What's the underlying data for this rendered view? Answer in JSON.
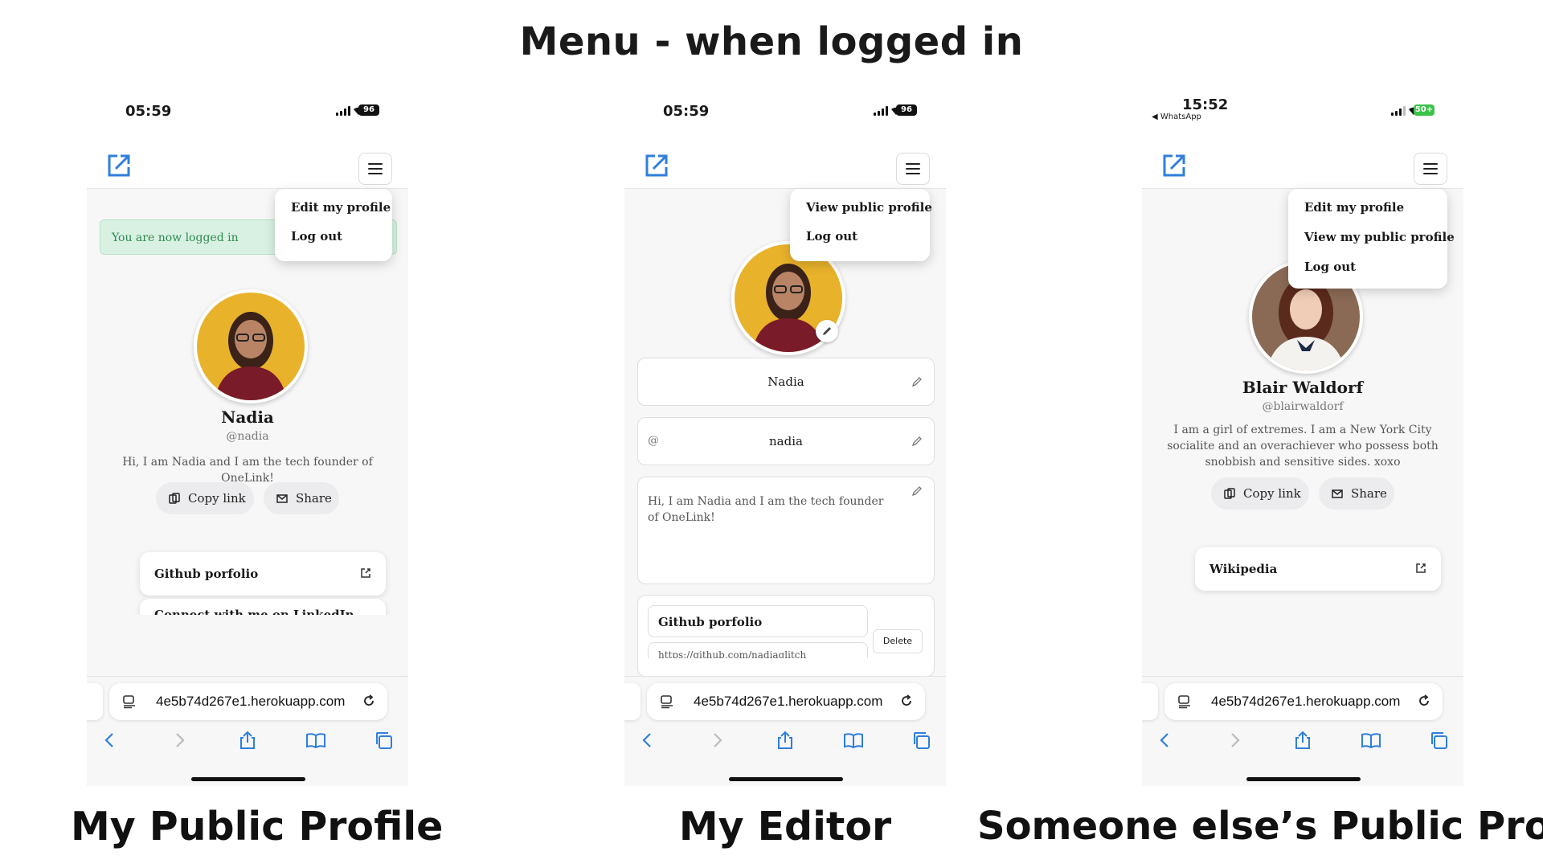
{
  "page_title": "Menu - when logged in",
  "captions": [
    "My Public Profile",
    "My Editor",
    "Someone else’s Public Profile"
  ],
  "panels": {
    "p1": {
      "time": "05:59",
      "battery": "96",
      "toast": "You are now logged in",
      "menu": [
        "Edit my profile",
        "Log out"
      ],
      "name": "Nadia",
      "handle": "@nadia",
      "bio": "Hi, I am Nadia and I am the tech founder of OneLink!",
      "copy_link": "Copy link",
      "share": "Share",
      "links": [
        "Github porfolio",
        "Connect with me on LinkedIn"
      ],
      "url": "4e5b74d267e1.herokuapp.com"
    },
    "p2": {
      "time": "05:59",
      "battery": "96",
      "menu": [
        "View public profile",
        "Log out"
      ],
      "name_field": "Nadia",
      "at_symbol": "@",
      "username_field": "nadia",
      "bio_field": "Hi, I am Nadia and I am the tech founder of OneLink!",
      "link_title": "Github porfolio",
      "link_url": "https://github.com/nadiaglitch",
      "delete": "Delete",
      "url": "4e5b74d267e1.herokuapp.com"
    },
    "p3": {
      "time": "15:52",
      "back_app": "◀ WhatsApp",
      "battery": "50+",
      "menu": [
        "Edit my profile",
        "View my public profile",
        "Log out"
      ],
      "name": "Blair Waldorf",
      "handle": "@blairwaldorf",
      "bio": "I am a girl of extremes. I am a New York City socialite and an overachiever who possess both snobbish and sensitive sides. xoxo",
      "copy_link": "Copy link",
      "share": "Share",
      "links": [
        "Wikipedia"
      ],
      "url": "4e5b74d267e1.herokuapp.com"
    }
  },
  "colors": {
    "accent": "#2f7fdc",
    "toast_bg": "#d9f1e2",
    "toast_text": "#2f8a52",
    "yellow_bg": "#e9b22b"
  }
}
